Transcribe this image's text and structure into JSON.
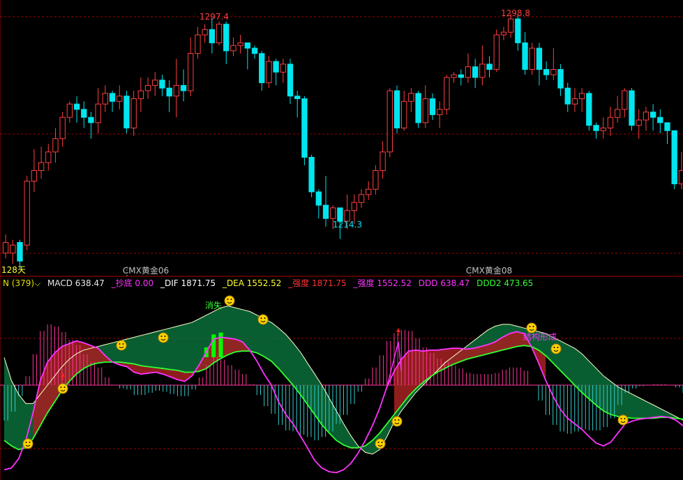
{
  "colors": {
    "background": "#000000",
    "up_candle": "#ff4040",
    "down_candle": "#00e5ee",
    "grid": "#a00000",
    "frame": "#b00000",
    "dif_line": "#ff33ff",
    "dea_line": "#33ff33",
    "ddd2_line": "#ffffcc",
    "hist_up": "#ff3399",
    "hist_down": "#33cccc",
    "band_red": "#a02020",
    "band_green": "#0a6e3a",
    "bright_green": "#00ff00",
    "emoji": "#ffd200"
  },
  "main_panel": {
    "period_label": "128天",
    "contract_labels": [
      "CMX黄金06",
      "CMX黄金08"
    ],
    "high_labels": [
      "1297.4",
      "1298.8"
    ],
    "low_labels": [
      "1214.3"
    ]
  },
  "indicator_panel": {
    "header": {
      "name": "N (379)",
      "dropdown_icon": "chevron-down-icon",
      "macd": "MACD 638.47",
      "chaodi": "_抄底 0.00",
      "dif": "_DIF 1871.75",
      "dea": "_DEA 1552.52",
      "qiangdu1": "_强度 1871.75",
      "qiangdu2": "_强度 1552.52",
      "ddd": "DDD 638.47",
      "ddd2": "DDD2 473.65"
    },
    "annotations": {
      "xiaoshi": "消失",
      "jiegou": "结构形成"
    }
  },
  "chart_data": [
    {
      "type": "candlestick",
      "title": "",
      "xlabel": "",
      "ylabel": "",
      "price_range": [
        1205,
        1302
      ],
      "grid": true,
      "candles": [
        [
          1209,
          1213,
          1207,
          1216
        ],
        [
          1209,
          1212,
          1205,
          1214
        ],
        [
          1213,
          1206,
          1203,
          1214
        ],
        [
          1212,
          1236,
          1210,
          1238
        ],
        [
          1236,
          1240,
          1232,
          1248
        ],
        [
          1240,
          1243,
          1237,
          1249
        ],
        [
          1243,
          1247,
          1240,
          1250
        ],
        [
          1247,
          1252,
          1243,
          1256
        ],
        [
          1252,
          1260,
          1249,
          1262
        ],
        [
          1260,
          1265,
          1258,
          1266
        ],
        [
          1265,
          1263,
          1258,
          1268
        ],
        [
          1263,
          1260,
          1256,
          1266
        ],
        [
          1260,
          1258,
          1252,
          1262
        ],
        [
          1258,
          1265,
          1254,
          1271
        ],
        [
          1265,
          1269,
          1262,
          1272
        ],
        [
          1269,
          1266,
          1262,
          1270
        ],
        [
          1266,
          1268,
          1263,
          1272
        ],
        [
          1268,
          1256,
          1254,
          1270
        ],
        [
          1256,
          1267,
          1253,
          1270
        ],
        [
          1267,
          1270,
          1262,
          1275
        ],
        [
          1270,
          1272,
          1267,
          1275
        ],
        [
          1272,
          1274,
          1268,
          1277
        ],
        [
          1274,
          1271,
          1268,
          1276
        ],
        [
          1271,
          1268,
          1262,
          1274
        ],
        [
          1268,
          1272,
          1260,
          1282
        ],
        [
          1272,
          1270,
          1266,
          1278
        ],
        [
          1270,
          1284,
          1268,
          1290
        ],
        [
          1284,
          1291,
          1282,
          1294
        ],
        [
          1291,
          1293,
          1288,
          1295
        ],
        [
          1293,
          1288,
          1284,
          1297.4
        ],
        [
          1288,
          1295,
          1287,
          1296
        ],
        [
          1295,
          1285,
          1280,
          1296
        ],
        [
          1285,
          1287,
          1283,
          1290
        ],
        [
          1287,
          1288,
          1284,
          1291
        ],
        [
          1288,
          1286,
          1278,
          1288
        ],
        [
          1286,
          1284,
          1282,
          1287
        ],
        [
          1284,
          1273,
          1270,
          1285
        ],
        [
          1273,
          1281,
          1271,
          1283
        ],
        [
          1281,
          1277,
          1272,
          1282
        ],
        [
          1277,
          1280,
          1273,
          1282
        ],
        [
          1280,
          1268,
          1265,
          1282
        ],
        [
          1268,
          1267,
          1260,
          1270
        ],
        [
          1267,
          1245,
          1242,
          1268
        ],
        [
          1245,
          1232,
          1230,
          1246
        ],
        [
          1232,
          1227,
          1222,
          1233
        ],
        [
          1227,
          1222,
          1219,
          1238
        ],
        [
          1222,
          1226,
          1218,
          1227
        ],
        [
          1226,
          1221,
          1214.3,
          1226
        ],
        [
          1221,
          1225,
          1218,
          1231
        ],
        [
          1225,
          1228,
          1220,
          1231
        ],
        [
          1228,
          1231,
          1226,
          1233
        ],
        [
          1231,
          1233,
          1229,
          1236
        ],
        [
          1233,
          1240,
          1231,
          1242
        ],
        [
          1240,
          1247,
          1237,
          1251
        ],
        [
          1247,
          1270,
          1245,
          1271
        ],
        [
          1270,
          1256,
          1254,
          1272
        ],
        [
          1256,
          1266,
          1255,
          1270
        ],
        [
          1266,
          1269,
          1262,
          1271
        ],
        [
          1269,
          1258,
          1256,
          1270
        ],
        [
          1258,
          1267,
          1256,
          1272
        ],
        [
          1267,
          1261,
          1259,
          1269
        ],
        [
          1261,
          1263,
          1256,
          1266
        ],
        [
          1263,
          1275,
          1261,
          1276
        ],
        [
          1275,
          1276,
          1273,
          1277
        ],
        [
          1276,
          1275,
          1272,
          1278
        ],
        [
          1275,
          1279,
          1273,
          1284
        ],
        [
          1279,
          1275,
          1271,
          1282
        ],
        [
          1275,
          1280,
          1272,
          1287
        ],
        [
          1280,
          1278,
          1275,
          1283
        ],
        [
          1278,
          1291,
          1277,
          1293
        ],
        [
          1291,
          1292,
          1289,
          1294
        ],
        [
          1292,
          1297,
          1290,
          1299
        ],
        [
          1297,
          1288,
          1285,
          1298.8
        ],
        [
          1288,
          1278,
          1276,
          1292
        ],
        [
          1278,
          1286,
          1276,
          1288
        ],
        [
          1286,
          1278,
          1272,
          1288
        ],
        [
          1278,
          1276,
          1274,
          1281
        ],
        [
          1276,
          1278,
          1274,
          1286
        ],
        [
          1278,
          1271,
          1268,
          1280
        ],
        [
          1271,
          1265,
          1262,
          1273
        ],
        [
          1265,
          1267,
          1262,
          1271
        ],
        [
          1267,
          1269,
          1262,
          1271
        ],
        [
          1269,
          1257,
          1255,
          1270
        ],
        [
          1257,
          1255,
          1252,
          1258
        ],
        [
          1255,
          1256,
          1252,
          1260
        ],
        [
          1256,
          1260,
          1253,
          1264
        ],
        [
          1260,
          1263,
          1258,
          1268
        ],
        [
          1263,
          1270,
          1260,
          1271
        ],
        [
          1270,
          1257,
          1255,
          1271
        ],
        [
          1257,
          1259,
          1252,
          1263
        ],
        [
          1259,
          1262,
          1255,
          1264
        ],
        [
          1262,
          1260,
          1255,
          1265
        ],
        [
          1260,
          1258,
          1254,
          1263
        ],
        [
          1258,
          1255,
          1250,
          1258
        ],
        [
          1255,
          1235,
          1233,
          1255
        ],
        [
          1235,
          1240,
          1233,
          1247
        ]
      ]
    },
    {
      "type": "line",
      "title": "",
      "xlabel": "",
      "ylabel": "",
      "value_range": [
        -1.0,
        1.0
      ],
      "grid": true,
      "series": [
        {
          "role": "dif",
          "values": [
            -0.92,
            -0.9,
            -0.8,
            -0.6,
            -0.3,
            0.05,
            0.25,
            0.35,
            0.42,
            0.45,
            0.48,
            0.46,
            0.43,
            0.4,
            0.32,
            0.25,
            0.22,
            0.2,
            0.14,
            0.12,
            0.13,
            0.14,
            0.12,
            0.09,
            0.06,
            0.04,
            0.1,
            0.22,
            0.36,
            0.5,
            0.52,
            0.51,
            0.5,
            0.47,
            0.38,
            0.26,
            0.12,
            0.0,
            -0.18,
            -0.32,
            -0.42,
            -0.55,
            -0.68,
            -0.82,
            -0.9,
            -0.94,
            -0.95,
            -0.92,
            -0.85,
            -0.74,
            -0.6,
            -0.44,
            -0.25,
            -0.02,
            0.15,
            0.28,
            0.37,
            0.38,
            0.37,
            0.38,
            0.38,
            0.39,
            0.4,
            0.4,
            0.39,
            0.4,
            0.42,
            0.44,
            0.47,
            0.52,
            0.56,
            0.58,
            0.56,
            0.42,
            0.24,
            0.05,
            -0.12,
            -0.26,
            -0.36,
            -0.42,
            -0.48,
            -0.56,
            -0.63,
            -0.66,
            -0.62,
            -0.52,
            -0.42,
            -0.39,
            -0.37,
            -0.36,
            -0.35,
            -0.34,
            -0.35,
            -0.38,
            -0.44
          ]
        },
        {
          "role": "dea",
          "values": [
            -0.6,
            -0.66,
            -0.7,
            -0.68,
            -0.58,
            -0.44,
            -0.3,
            -0.18,
            -0.06,
            0.04,
            0.12,
            0.18,
            0.22,
            0.24,
            0.25,
            0.25,
            0.25,
            0.24,
            0.23,
            0.21,
            0.2,
            0.19,
            0.18,
            0.17,
            0.16,
            0.14,
            0.14,
            0.15,
            0.18,
            0.24,
            0.29,
            0.33,
            0.36,
            0.37,
            0.37,
            0.35,
            0.31,
            0.26,
            0.18,
            0.09,
            0.0,
            -0.1,
            -0.21,
            -0.32,
            -0.43,
            -0.52,
            -0.6,
            -0.65,
            -0.68,
            -0.68,
            -0.66,
            -0.6,
            -0.52,
            -0.42,
            -0.32,
            -0.22,
            -0.12,
            -0.04,
            0.03,
            0.09,
            0.14,
            0.18,
            0.22,
            0.25,
            0.28,
            0.3,
            0.32,
            0.34,
            0.36,
            0.38,
            0.4,
            0.42,
            0.43,
            0.42,
            0.38,
            0.32,
            0.24,
            0.16,
            0.08,
            0.0,
            -0.08,
            -0.15,
            -0.22,
            -0.28,
            -0.32,
            -0.34,
            -0.35,
            -0.36,
            -0.36,
            -0.36,
            -0.36,
            -0.35,
            -0.35,
            -0.36,
            -0.37
          ]
        },
        {
          "role": "ddd2",
          "values": [
            0.3,
            0.05,
            -0.1,
            -0.2,
            -0.2,
            -0.1,
            0.0,
            0.1,
            0.2,
            0.28,
            0.34,
            0.38,
            0.4,
            0.42,
            0.44,
            0.46,
            0.48,
            0.5,
            0.52,
            0.54,
            0.56,
            0.58,
            0.6,
            0.62,
            0.64,
            0.66,
            0.68,
            0.72,
            0.76,
            0.8,
            0.84,
            0.86,
            0.84,
            0.82,
            0.8,
            0.76,
            0.72,
            0.68,
            0.62,
            0.55,
            0.46,
            0.36,
            0.24,
            0.12,
            0.0,
            -0.14,
            -0.28,
            -0.42,
            -0.55,
            -0.66,
            -0.73,
            -0.75,
            -0.7,
            -0.56,
            -0.4,
            -0.28,
            -0.18,
            -0.08,
            0.0,
            0.08,
            0.16,
            0.24,
            0.3,
            0.36,
            0.42,
            0.48,
            0.54,
            0.6,
            0.64,
            0.66,
            0.66,
            0.64,
            0.62,
            0.6,
            0.58,
            0.56,
            0.52,
            0.48,
            0.44,
            0.4,
            0.34,
            0.26,
            0.18,
            0.1,
            0.04,
            -0.02,
            -0.06,
            -0.1,
            -0.14,
            -0.18,
            -0.22,
            -0.26,
            -0.3,
            -0.34,
            -0.38
          ]
        }
      ]
    }
  ]
}
